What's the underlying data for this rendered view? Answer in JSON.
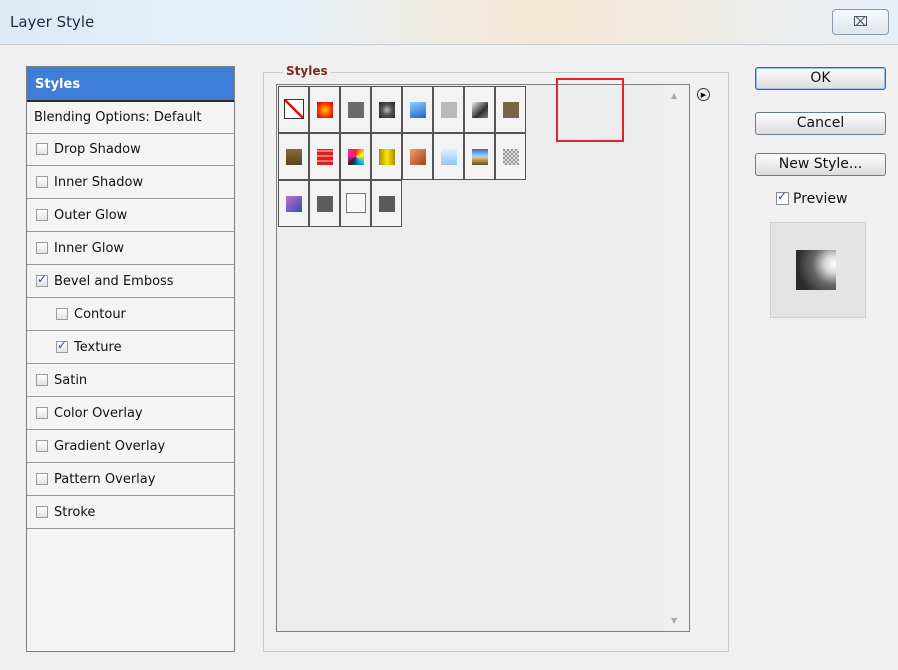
{
  "window": {
    "title": "Layer Style",
    "close_icon": "close-x-icon"
  },
  "left_panel": {
    "header": "Styles",
    "blending_options": "Blending Options: Default",
    "items": [
      {
        "label": "Drop Shadow",
        "checked": false,
        "indent": false
      },
      {
        "label": "Inner Shadow",
        "checked": false,
        "indent": false
      },
      {
        "label": "Outer Glow",
        "checked": false,
        "indent": false
      },
      {
        "label": "Inner Glow",
        "checked": false,
        "indent": false
      },
      {
        "label": "Bevel and Emboss",
        "checked": true,
        "indent": false
      },
      {
        "label": "Contour",
        "checked": false,
        "indent": true
      },
      {
        "label": "Texture",
        "checked": true,
        "indent": true
      },
      {
        "label": "Satin",
        "checked": false,
        "indent": false
      },
      {
        "label": "Color Overlay",
        "checked": false,
        "indent": false
      },
      {
        "label": "Gradient Overlay",
        "checked": false,
        "indent": false
      },
      {
        "label": "Pattern Overlay",
        "checked": false,
        "indent": false
      },
      {
        "label": "Stroke",
        "checked": false,
        "indent": false
      }
    ]
  },
  "styles_group": {
    "title": "Styles",
    "swatches": [
      "none-style-icon",
      "red-glow-style-icon",
      "gray-square-style-icon",
      "dark-round-style-icon",
      "blue-gradient-style-icon",
      "light-gray-style-icon",
      "chrome-style-icon",
      "bronze-style-icon",
      "bronze-dark-style-icon",
      "red-stripes-style-icon",
      "color-mix-style-icon",
      "yellow-gradient-style-icon",
      "orange-gradient-style-icon",
      "light-blue-style-icon",
      "sky-style-icon",
      "texture-gray-style-icon",
      "purple-blue-style-icon",
      "dark-gray-style-icon",
      "outline-style-icon",
      "dark-gray-2-style-icon"
    ],
    "selected_index": 6,
    "menu_icon": "flyout-menu-icon"
  },
  "buttons": {
    "ok": "OK",
    "cancel": "Cancel",
    "new_style": "New Style..."
  },
  "preview": {
    "label": "Preview",
    "checked": true
  }
}
